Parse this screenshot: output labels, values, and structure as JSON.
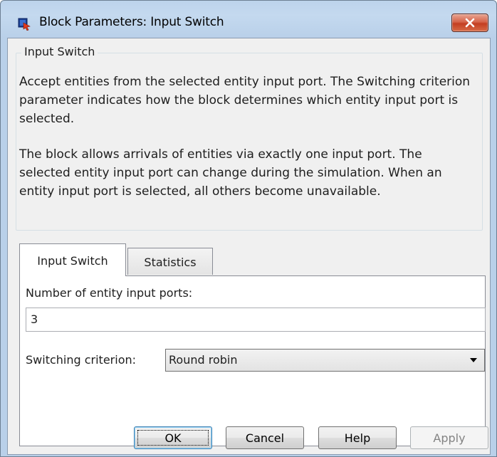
{
  "window": {
    "title": "Block Parameters: Input Switch",
    "app_icon": "simulink-block-icon",
    "close_icon": "close-x-icon"
  },
  "groupbox": {
    "legend": "Input Switch",
    "description_1": "Accept entities from the selected entity input port. The Switching criterion parameter indicates how the block determines which entity input port is selected.",
    "description_2": "The block allows arrivals of entities via exactly one input port. The selected entity input port can change during the simulation. When an entity input port is selected, all others become unavailable."
  },
  "tabs": [
    {
      "label": "Input Switch",
      "active": true
    },
    {
      "label": "Statistics",
      "active": false
    }
  ],
  "form": {
    "num_ports_label": "Number of entity input ports:",
    "num_ports_value": "3",
    "criterion_label": "Switching criterion:",
    "criterion_value": "Round robin",
    "criterion_dropdown_icon": "chevron-down-icon"
  },
  "buttons": {
    "ok": "OK",
    "cancel": "Cancel",
    "help": "Help",
    "apply": "Apply"
  },
  "colors": {
    "frame": "#b9d0e9",
    "close_button": "#c33e22",
    "default_button_border": "#3c7fb1"
  }
}
